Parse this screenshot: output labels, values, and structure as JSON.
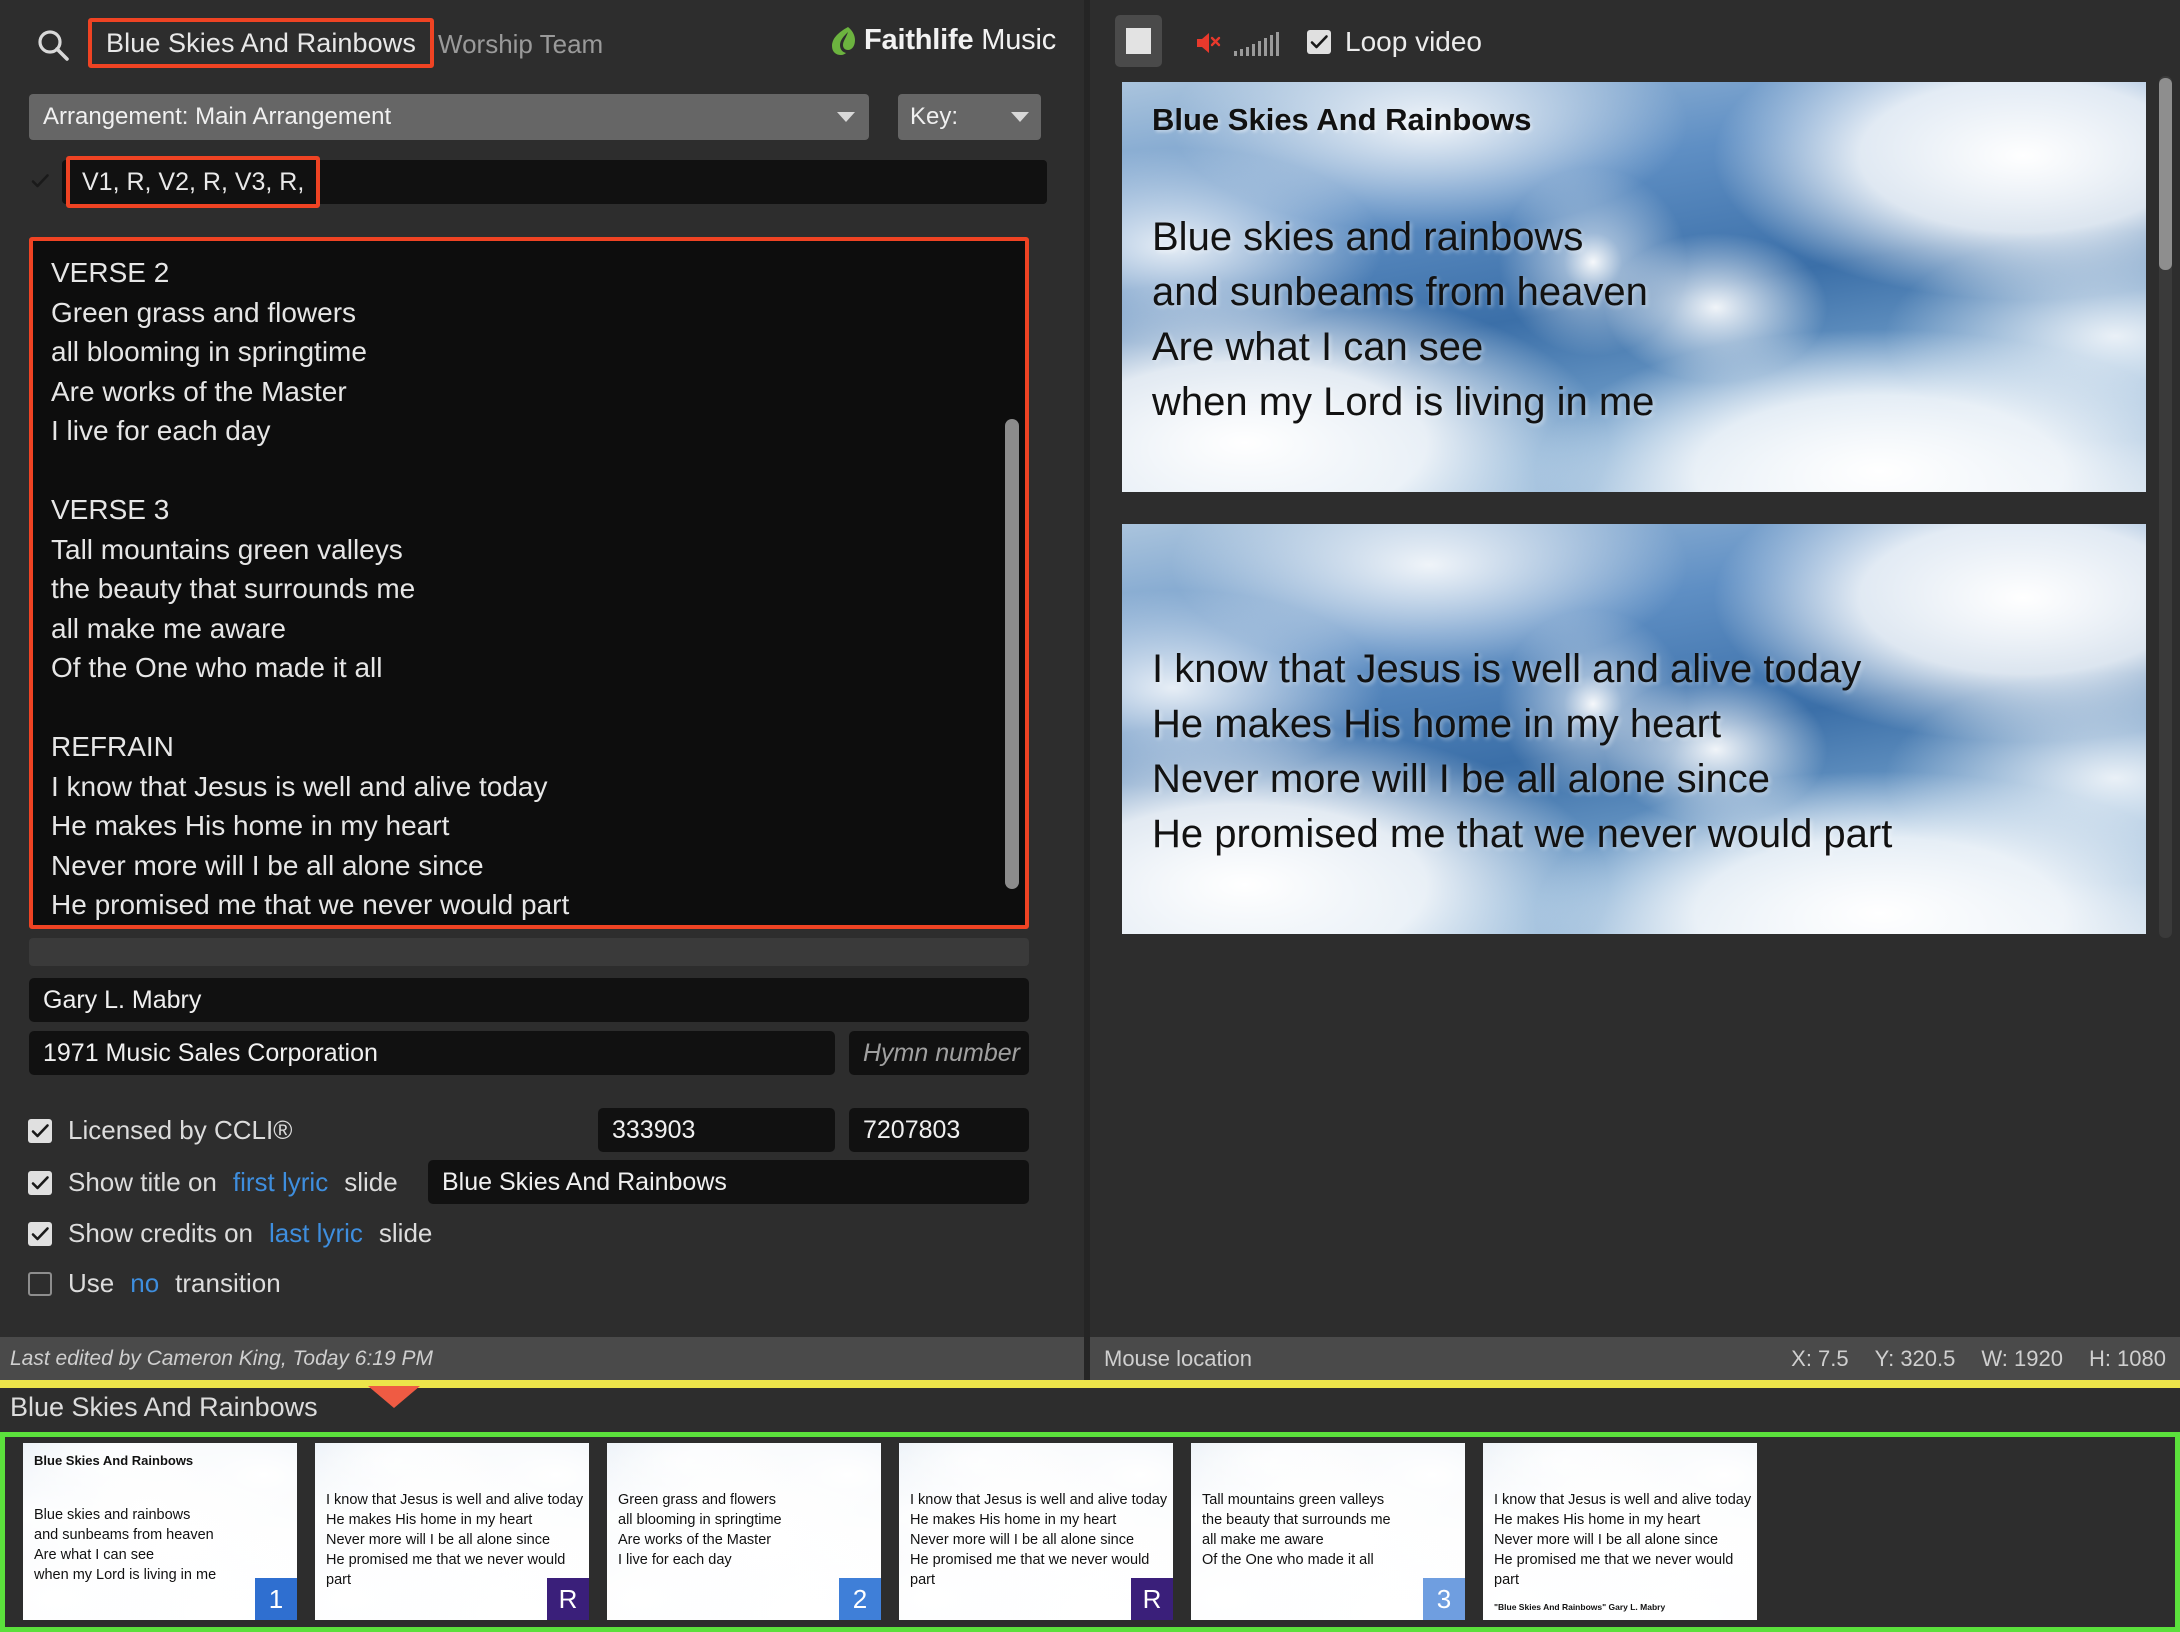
{
  "header": {
    "search_icon": "search-icon",
    "song_title": "Blue Skies And Rainbows",
    "subtitle": "Worship Team",
    "brand_bold": "Faithlife",
    "brand_light": " Music"
  },
  "arrangement": {
    "label": "Arrangement: Main Arrangement",
    "key_label": "Key:"
  },
  "sequence": {
    "value": "V1, R, V2, R, V3, R,"
  },
  "lyrics": {
    "text": "VERSE 2\nGreen grass and flowers\nall blooming in springtime\nAre works of the Master\nI live for each day\n\nVERSE 3\nTall mountains green valleys\nthe beauty that surrounds me\nall make me aware\nOf the One who made it all\n\nREFRAIN\nI know that Jesus is well and alive today\nHe makes His home in my heart\nNever more will I be all alone since\nHe promised me that we never would part"
  },
  "metadata": {
    "author": "Gary L. Mabry",
    "copyright": "1971 Music Sales Corporation",
    "hymn_number_placeholder": "Hymn number",
    "ccli_number": "333903",
    "song_number": "7207803",
    "title_slide_text": "Blue Skies And Rainbows"
  },
  "options": {
    "ccli_pre": "Licensed by CCLI®",
    "title_pre": "Show title on",
    "title_link": "first lyric",
    "title_post": "slide",
    "credits_pre": "Show credits on",
    "credits_link": "last lyric",
    "credits_post": "slide",
    "transition_pre": "Use",
    "transition_link": "no",
    "transition_post": "transition"
  },
  "left_status": {
    "text": "Last edited by Cameron King, Today 6:19 PM"
  },
  "player": {
    "stop_icon": "stop-icon",
    "mute_icon": "speaker-muted-icon",
    "loop_label": "Loop video"
  },
  "previews": [
    {
      "title": "Blue Skies And Rainbows",
      "lyrics": "Blue skies and rainbows\nand sunbeams from heaven\nAre what I can see\nwhen my Lord is living in me"
    },
    {
      "title": "",
      "lyrics": "I know that Jesus is well and alive today\nHe makes His home in my heart\nNever more will I be all alone since\nHe promised me that we never would part"
    }
  ],
  "right_status": {
    "label": "Mouse location",
    "x": "X: 7.5",
    "y": "Y: 320.5",
    "w": "W: 1920",
    "h": "H: 1080"
  },
  "filmstrip": {
    "title": "Blue Skies And Rainbows",
    "selection_color": "#5be03c",
    "slides": [
      {
        "slide_title": "Blue Skies And Rainbows",
        "lyrics": "Blue skies and rainbows\nand sunbeams from heaven\nAre what I can see\nwhen my Lord is living in me",
        "badge": "1",
        "badge_kind": "b-num1",
        "credit": ""
      },
      {
        "slide_title": "",
        "lyrics": "I know that Jesus is well and alive today\nHe makes His home in my heart\nNever more will I be all alone since\nHe promised me that we never would part",
        "badge": "R",
        "badge_kind": "b-ref",
        "credit": ""
      },
      {
        "slide_title": "",
        "lyrics": "Green grass and flowers\nall blooming in springtime\nAre works of the Master\nI live for each day",
        "badge": "2",
        "badge_kind": "b-num2",
        "credit": ""
      },
      {
        "slide_title": "",
        "lyrics": "I know that Jesus is well and alive today\nHe makes His home in my heart\nNever more will I be all alone since\nHe promised me that we never would part",
        "badge": "R",
        "badge_kind": "b-ref",
        "credit": ""
      },
      {
        "slide_title": "",
        "lyrics": "Tall mountains green valleys\nthe beauty that surrounds me\nall make me aware\nOf the One who made it all",
        "badge": "3",
        "badge_kind": "b-num3",
        "credit": ""
      },
      {
        "slide_title": "",
        "lyrics": "I know that Jesus is well and alive today\nHe makes His home in my heart\nNever more will I be all alone since\nHe promised me that we never would part",
        "badge": "",
        "badge_kind": "",
        "credit": "\"Blue Skies And Rainbows\" Gary L. Mabry"
      }
    ]
  }
}
